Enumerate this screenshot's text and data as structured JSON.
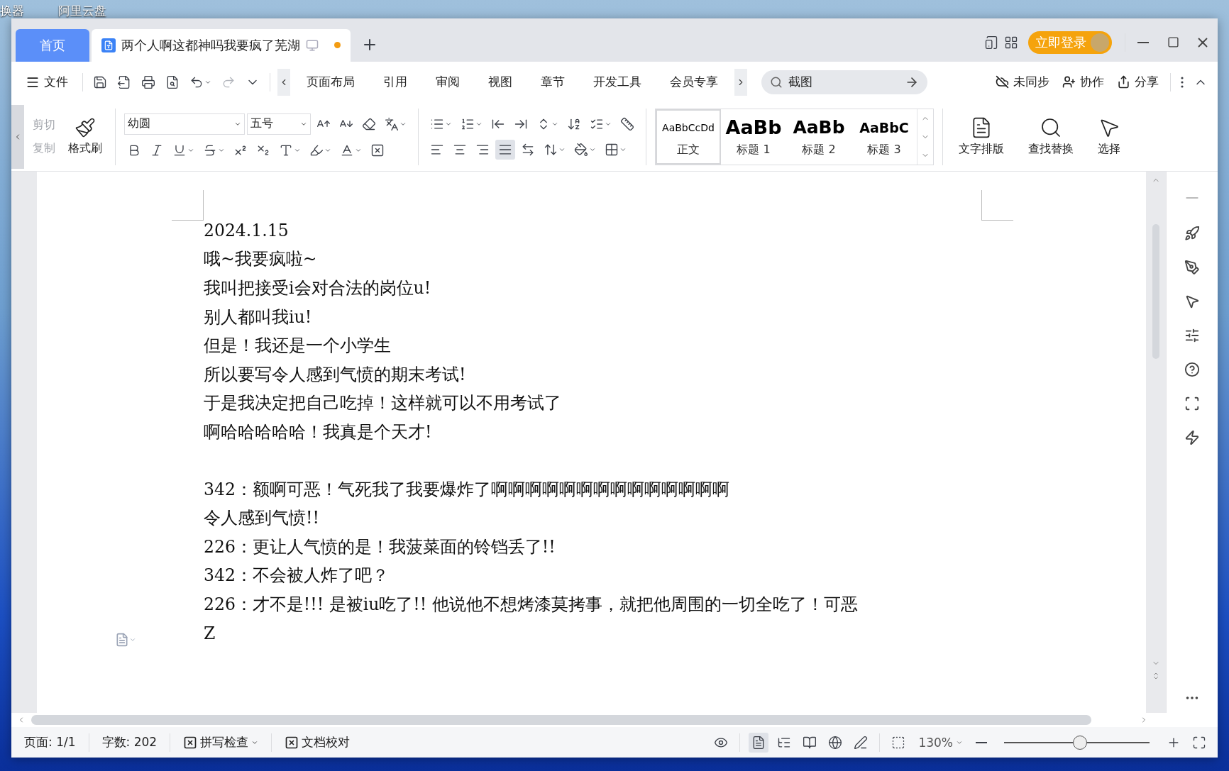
{
  "desktop": {
    "icon_labels": [
      "换器",
      "阿里云盘"
    ]
  },
  "tabs": [
    {
      "label": "首页",
      "kind": "home",
      "selected": false
    },
    {
      "label": "两个人啊这都神吗我要疯了芜湖",
      "kind": "document",
      "selected": true,
      "unsaved": true
    }
  ],
  "login_button": "立即登录",
  "menu": {
    "file": "文件",
    "redo_disabled": true,
    "items": [
      "页面布局",
      "引用",
      "审阅",
      "视图",
      "章节",
      "开发工具",
      "会员专享"
    ],
    "search": {
      "value": "截图"
    },
    "actions": [
      "未同步",
      "协作",
      "分享"
    ]
  },
  "ribbon": {
    "clipboard": [
      {
        "label": "剪切",
        "disabled": true
      },
      {
        "label": "复制",
        "disabled": true
      }
    ],
    "format_painter": "格式刷",
    "font": {
      "value": "幼圆"
    },
    "size": {
      "value": "五号"
    },
    "alignment": [
      {
        "kind": "left",
        "selected": false
      },
      {
        "kind": "center",
        "selected": false
      },
      {
        "kind": "right",
        "selected": false
      },
      {
        "kind": "justify",
        "selected": true
      },
      {
        "kind": "distributed",
        "selected": false
      }
    ],
    "styles": [
      {
        "preview": "AaBbCcDd",
        "label": "正文",
        "kind": "body",
        "selected": true
      },
      {
        "preview": "AaBb",
        "label": "标题 1",
        "kind": "h1",
        "selected": false
      },
      {
        "preview": "AaBb",
        "label": "标题 2",
        "kind": "h2",
        "selected": false
      },
      {
        "preview": "AaBbC",
        "label": "标题 3",
        "kind": "h3",
        "selected": false
      }
    ],
    "tools": [
      "文字排版",
      "查找替换",
      "选择"
    ]
  },
  "document": {
    "blocks": [
      [
        "2024.1.15",
        "哦~我要疯啦~",
        "我叫把接受i会对合法的岗位u!",
        "别人都叫我iu!",
        "但是！我还是一个小学生",
        "所以要写令人感到气愤的期末考试!",
        "于是我决定把自己吃掉！这样就可以不用考试了",
        "啊哈哈哈哈哈！我真是个天才!"
      ],
      [
        "342：额啊可恶！气死我了我要爆炸了啊啊啊啊啊啊啊啊啊啊啊啊啊啊",
        "令人感到气愤!!",
        "226：更让人气愤的是！我菠菜面的铃铛丢了!!",
        "342：不会被人炸了吧？",
        "226：才不是!!! 是被iu吃了!! 他说他不想烤漆莫拷事，就把他周围的一切全吃了！可恶",
        "Z"
      ]
    ]
  },
  "status_bar": {
    "page": "页面: 1/1",
    "words": "字数: 202",
    "spell_check": "拼写检查",
    "proofread": "文档校对",
    "views": [
      {
        "kind": "page",
        "selected": true
      },
      {
        "kind": "outline",
        "selected": false
      },
      {
        "kind": "read",
        "selected": false
      },
      {
        "kind": "web",
        "selected": false
      },
      {
        "kind": "write",
        "selected": false
      }
    ],
    "zoom": "130%",
    "zoom_slider": {
      "level": 0.52
    }
  }
}
